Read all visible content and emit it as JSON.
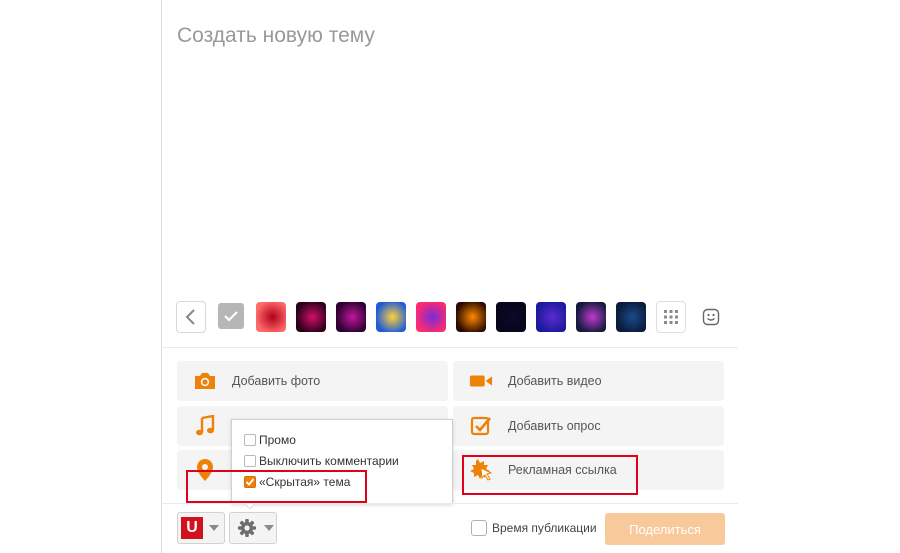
{
  "composer": {
    "title": "Создать новую тему"
  },
  "themes": {
    "back_icon": "chevron-left-icon",
    "items": [
      {
        "name": "theme-none",
        "colors": [
          "#b6b6b6",
          "#b6b6b6"
        ]
      },
      {
        "name": "theme-roses",
        "colors": [
          "#ff6b6b",
          "#b1001a"
        ]
      },
      {
        "name": "theme-pink-sparkle",
        "colors": [
          "#2a0018",
          "#d0106a"
        ]
      },
      {
        "name": "theme-purple-lights",
        "colors": [
          "#2a0030",
          "#c0189a"
        ]
      },
      {
        "name": "theme-smiley",
        "colors": [
          "#1e5bd6",
          "#ffd23c"
        ]
      },
      {
        "name": "theme-pink-hearts",
        "colors": [
          "#ff2a70",
          "#7a2bd8"
        ]
      },
      {
        "name": "theme-sunset",
        "colors": [
          "#2a0a00",
          "#ff8a00"
        ]
      },
      {
        "name": "theme-night-stars",
        "colors": [
          "#05051a",
          "#0a0a2a"
        ]
      },
      {
        "name": "theme-blue-stars",
        "colors": [
          "#1a1a9a",
          "#5a2ad0"
        ]
      },
      {
        "name": "theme-galaxy",
        "colors": [
          "#101a3a",
          "#c03ad0"
        ]
      },
      {
        "name": "theme-night-city",
        "colors": [
          "#0a1a3a",
          "#1a4a8a"
        ]
      }
    ]
  },
  "actions": {
    "add_photo": "Добавить фото",
    "add_video": "Добавить видео",
    "add_poll": "Добавить опрос",
    "ad_link": "Рекламная ссылка"
  },
  "settings_menu": {
    "promo": "Промо",
    "disable_comments": "Выключить комментарии",
    "hidden_topic": "«Скрытая» тема",
    "hidden_topic_checked": true
  },
  "footer": {
    "publish_time": "Время публикации",
    "share": "Поделиться"
  },
  "colors": {
    "accent": "#ee8208",
    "highlight": "#e0001b",
    "share_disabled": "#f8c99a"
  }
}
